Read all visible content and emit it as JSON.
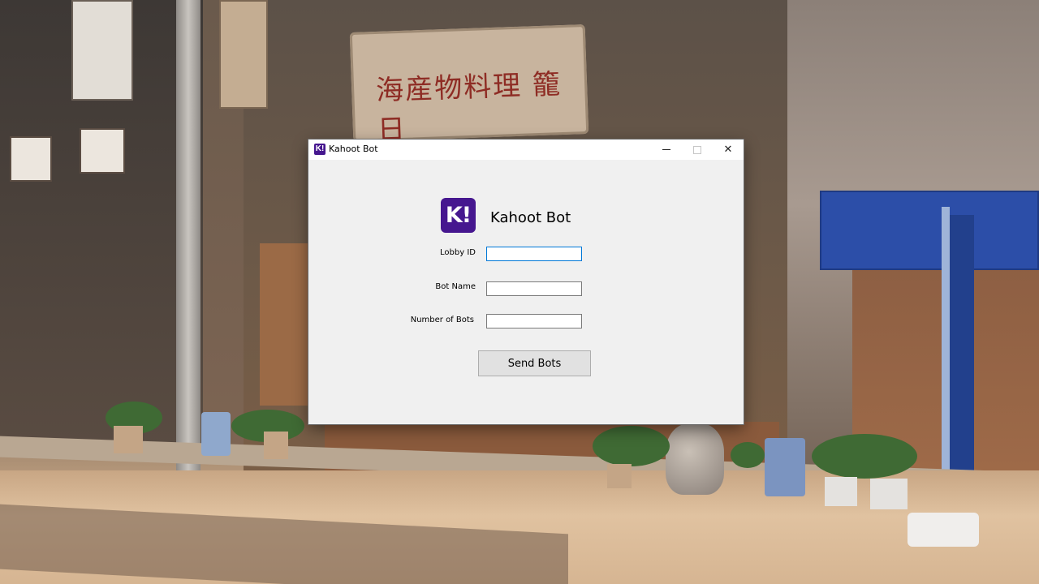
{
  "window": {
    "title": "Kahoot Bot",
    "controls": {
      "minimize_icon": "minimize-icon",
      "maximize_icon": "maximize-icon",
      "close_symbol": "✕"
    }
  },
  "app": {
    "logo_text": "K!",
    "logo_color": "#46178f",
    "heading": "Kahoot Bot"
  },
  "form": {
    "lobby_id": {
      "label": "Lobby ID",
      "value": ""
    },
    "bot_name": {
      "label": "Bot Name",
      "value": ""
    },
    "bot_count": {
      "label": "Number of Bots",
      "value": ""
    }
  },
  "actions": {
    "send_label": "Send Bots"
  },
  "desktop": {
    "shop_sign_text": "海産物料理 籠日"
  }
}
